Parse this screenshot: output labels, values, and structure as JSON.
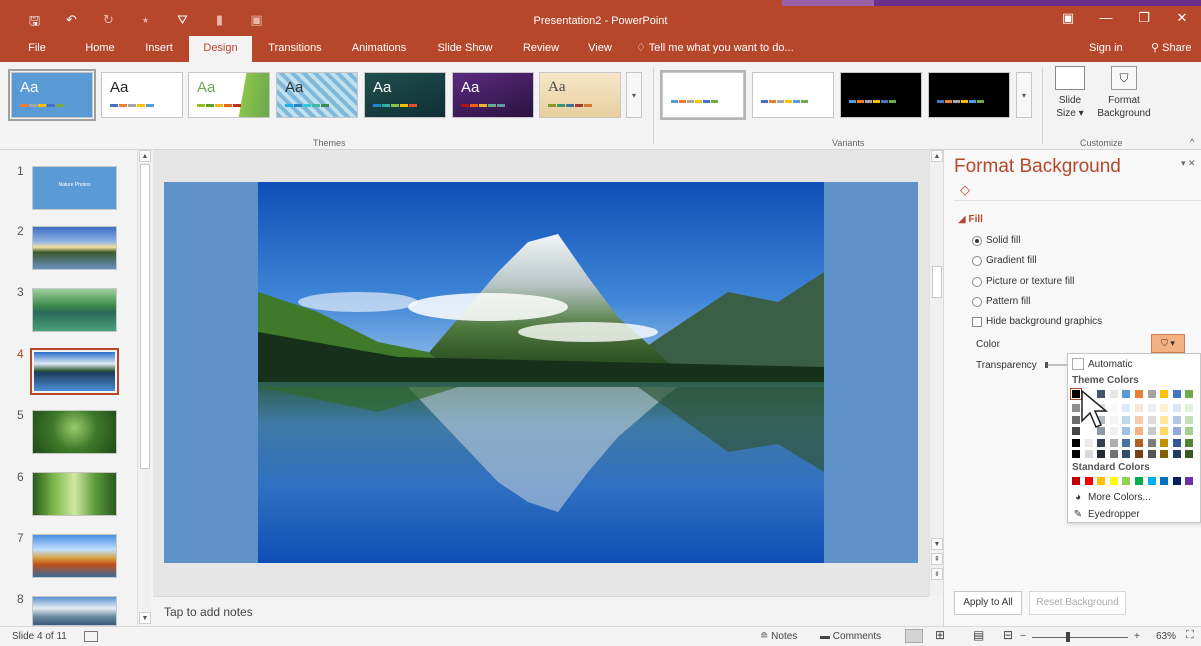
{
  "app": {
    "title": "Presentation2 - PowerPoint",
    "accent": "#b7472a"
  },
  "qat": {
    "icons": [
      "save-icon",
      "undo-icon",
      "redo-icon",
      "start-from-beginning-icon",
      "touch-mode-icon",
      "new-slide-icon",
      "customize-icon"
    ],
    "glyphs": [
      "🖫",
      "↶",
      "↻",
      "⭑",
      "⛛",
      "▮",
      "▣"
    ]
  },
  "window": {
    "ribbon_display": "▣",
    "minimize": "—",
    "restore": "❐",
    "close": "✕"
  },
  "tabs": [
    "File",
    "Home",
    "Insert",
    "Design",
    "Transitions",
    "Animations",
    "Slide Show",
    "Review",
    "View"
  ],
  "active_tab": "Design",
  "tell_me": "Tell me what you want to do...",
  "sign_in": "Sign in",
  "share": "Share",
  "ribbon": {
    "themes_label": "Themes",
    "variants_label": "Variants",
    "customize_label": "Customize",
    "theme_glyph": "Aa",
    "slide_size_label_1": "Slide",
    "slide_size_label_2": "Size ▾",
    "format_background_label_1": "Format",
    "format_background_label_2": "Background"
  },
  "slides": {
    "current": 4,
    "thumbs": [
      {
        "num": "1",
        "title": "Nature Photos"
      },
      {
        "num": "2"
      },
      {
        "num": "3"
      },
      {
        "num": "4"
      },
      {
        "num": "5"
      },
      {
        "num": "6"
      },
      {
        "num": "7"
      },
      {
        "num": "8"
      }
    ]
  },
  "notes_placeholder": "Tap to add notes",
  "pane": {
    "title": "Format Background",
    "fill_heading": "Fill",
    "options": [
      "Solid fill",
      "Gradient fill",
      "Picture or texture fill",
      "Pattern fill"
    ],
    "selected_option": "Solid fill",
    "hide_graphics": "Hide background graphics",
    "color_label": "Color",
    "transparency_label": "Transparency",
    "apply_all": "Apply to All",
    "reset": "Reset Background"
  },
  "color_menu": {
    "automatic": "Automatic",
    "theme_colors": "Theme Colors",
    "standard_colors": "Standard Colors",
    "more_colors": "More Colors...",
    "eyedropper": "Eyedropper",
    "theme_top": [
      "#000000",
      "#ffffff",
      "#44546a",
      "#e7e6e6",
      "#5b9bd5",
      "#ed7d31",
      "#a5a5a5",
      "#ffc000",
      "#4472c4",
      "#70ad47"
    ],
    "standard": [
      "#c00000",
      "#ff0000",
      "#ffc000",
      "#ffff00",
      "#92d050",
      "#00b050",
      "#00b0f0",
      "#0070c0",
      "#002060",
      "#7030a0"
    ]
  },
  "status": {
    "slide_info": "Slide 4 of 11",
    "notes": "Notes",
    "comments": "Comments",
    "zoom": "63%"
  }
}
